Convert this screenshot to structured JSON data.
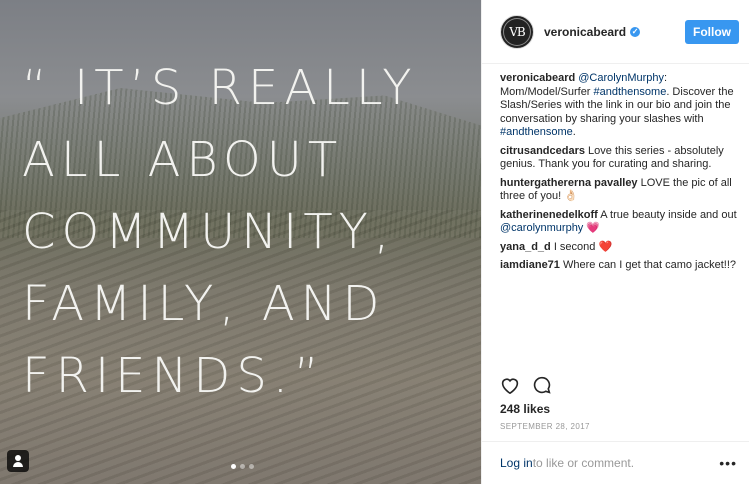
{
  "media": {
    "quote_lines": [
      "“ IT’S REALLY",
      "ALL ABOUT",
      "COMMUNITY,",
      "FAMILY, AND",
      "FRIENDS.”"
    ],
    "carousel_dots": 3
  },
  "header": {
    "avatar_text": "VB",
    "username": "veronicabeard",
    "follow_label": "Follow"
  },
  "caption": {
    "user": "veronicabeard",
    "mention": "@CarolynMurphy",
    "text1": ": Mom/Model/Surfer ",
    "hashtag1": "#andthensome",
    "text2": ". Discover the Slash/Series with the link in our bio and join the conversation by sharing your slashes with ",
    "hashtag2": "#andthensome",
    "text3": "."
  },
  "comments": [
    {
      "user": "citrusandcedars",
      "text": "Love this series - absolutely genius. Thank you for curating and sharing."
    },
    {
      "user": "huntergathererna pavalley",
      "text": "LOVE the pic of all three of you! 👌🏻"
    },
    {
      "user": "katherinenedelkoff",
      "text": "A true beauty inside and out ",
      "mention": "@carolynmurphy",
      "emoji": "💗"
    },
    {
      "user": "yana_d_d",
      "text": "I second ",
      "emoji": "❤️"
    },
    {
      "user": "iamdiane71",
      "text": "Where can I get that camo jacket!!?"
    }
  ],
  "actions": {
    "like_icon": "heart-icon",
    "comment_icon": "comment-icon"
  },
  "likes": "248 likes",
  "date": "SEPTEMBER 28, 2017",
  "footer": {
    "login_label": "Log in",
    "rest": " to like or comment.",
    "more": "•••"
  }
}
